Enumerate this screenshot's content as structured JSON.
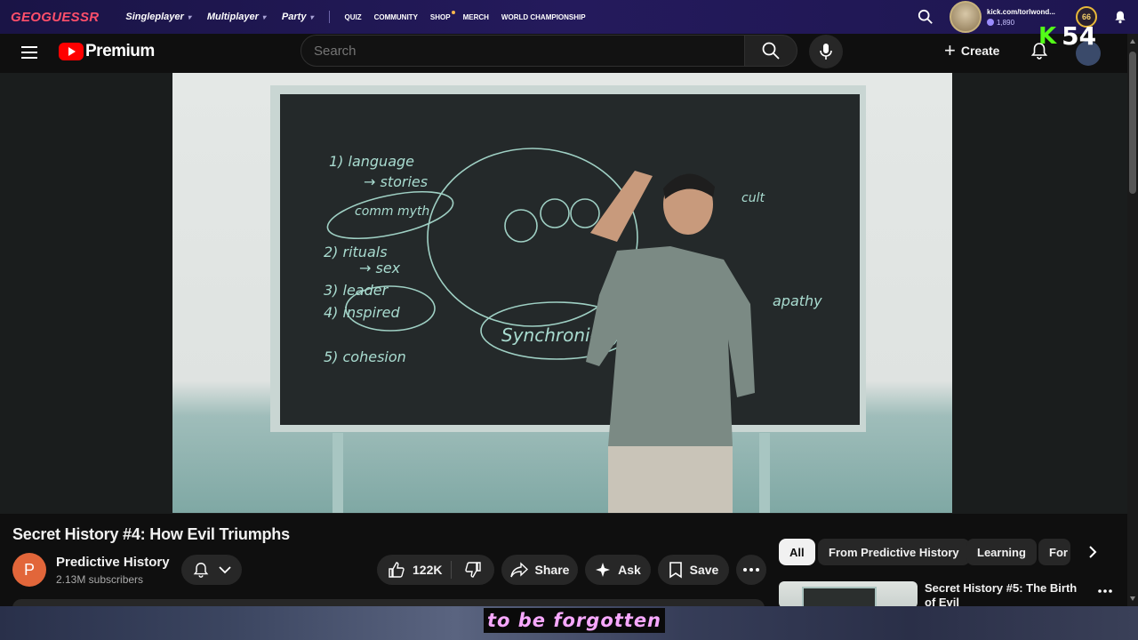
{
  "geoguessr": {
    "logo": "GEOGUESSR",
    "nav_main": [
      {
        "label": "Singleplayer"
      },
      {
        "label": "Multiplayer"
      },
      {
        "label": "Party"
      }
    ],
    "nav_small": [
      {
        "label": "QUIZ"
      },
      {
        "label": "COMMUNITY"
      },
      {
        "label": "SHOP"
      },
      {
        "label": "MERCH"
      },
      {
        "label": "WORLD CHAMPIONSHIP"
      }
    ],
    "user": {
      "name": "kick.com/torlwond...",
      "coins": "1,890",
      "level": "66"
    }
  },
  "kick_overlay": {
    "logo": "K",
    "count": "54"
  },
  "youtube": {
    "brand": "Premium",
    "search_placeholder": "Search",
    "create_label": "Create"
  },
  "video": {
    "title": "Secret History #4: How Evil Triumphs",
    "channel": {
      "initial": "P",
      "name": "Predictive History",
      "subscribers": "2.13M subscribers"
    },
    "actions": {
      "likes": "122K",
      "share": "Share",
      "ask": "Ask",
      "save": "Save"
    }
  },
  "chips": [
    {
      "label": "All",
      "active": true
    },
    {
      "label": "From Predictive History",
      "active": false
    },
    {
      "label": "Learning",
      "active": false
    },
    {
      "label": "For",
      "active": false
    }
  ],
  "recommendation": {
    "title": "Secret History #5: The Birth of Evil"
  },
  "caption": "to be forgotten",
  "board": {
    "items": [
      "1) language",
      "→ stories",
      "comm myth",
      "2) rituals",
      "→ sex",
      "3) leader",
      "4) inspired",
      "5) cohesion",
      "Synchronicity",
      "apathy",
      "cult"
    ]
  }
}
